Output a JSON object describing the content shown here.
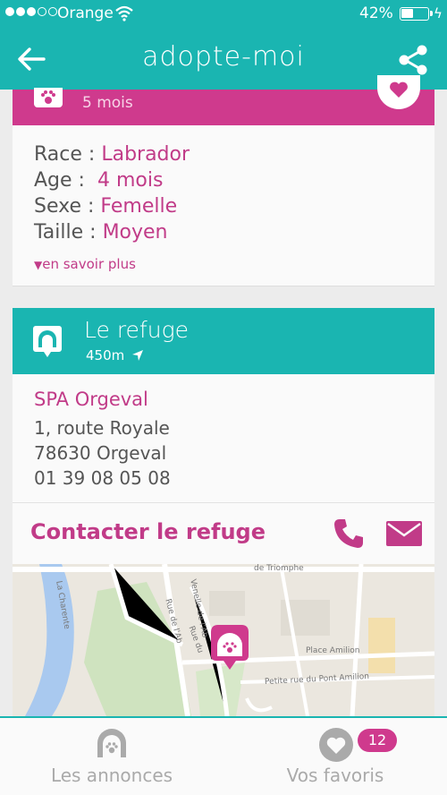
{
  "status_bar": {
    "carrier": "Orange",
    "battery": "42%"
  },
  "header": {
    "title": "adopte-moi"
  },
  "pet": {
    "age_subtitle": "5 mois",
    "details": [
      {
        "label": "Race :",
        "value": "Labrador"
      },
      {
        "label": "Age :",
        "value": "4 mois"
      },
      {
        "label": "Sexe :",
        "value": "Femelle"
      },
      {
        "label": "Taille :",
        "value": "Moyen"
      }
    ],
    "more_link": "en savoir plus"
  },
  "refuge": {
    "title": "Le refuge",
    "distance": "450m",
    "name": "SPA Orgeval",
    "address_line1": "1, route Royale",
    "address_line2": "78630 Orgeval",
    "phone": "01 39 08 05 08",
    "contact_label": "Contacter le refuge"
  },
  "map": {
    "labels": [
      "La Charente",
      "Rue de l'Ab",
      "Venelle de l'Ab",
      "Rue du",
      "Petite rue du Pont Amilion",
      "Place Amilion",
      "de Triomphe"
    ]
  },
  "tabs": [
    {
      "label": "Les annonces"
    },
    {
      "label": "Vos favoris",
      "badge": "12"
    }
  ],
  "colors": {
    "teal": "#1ab5b1",
    "pink": "#cf3a8d",
    "pink_text": "#c13b88"
  }
}
